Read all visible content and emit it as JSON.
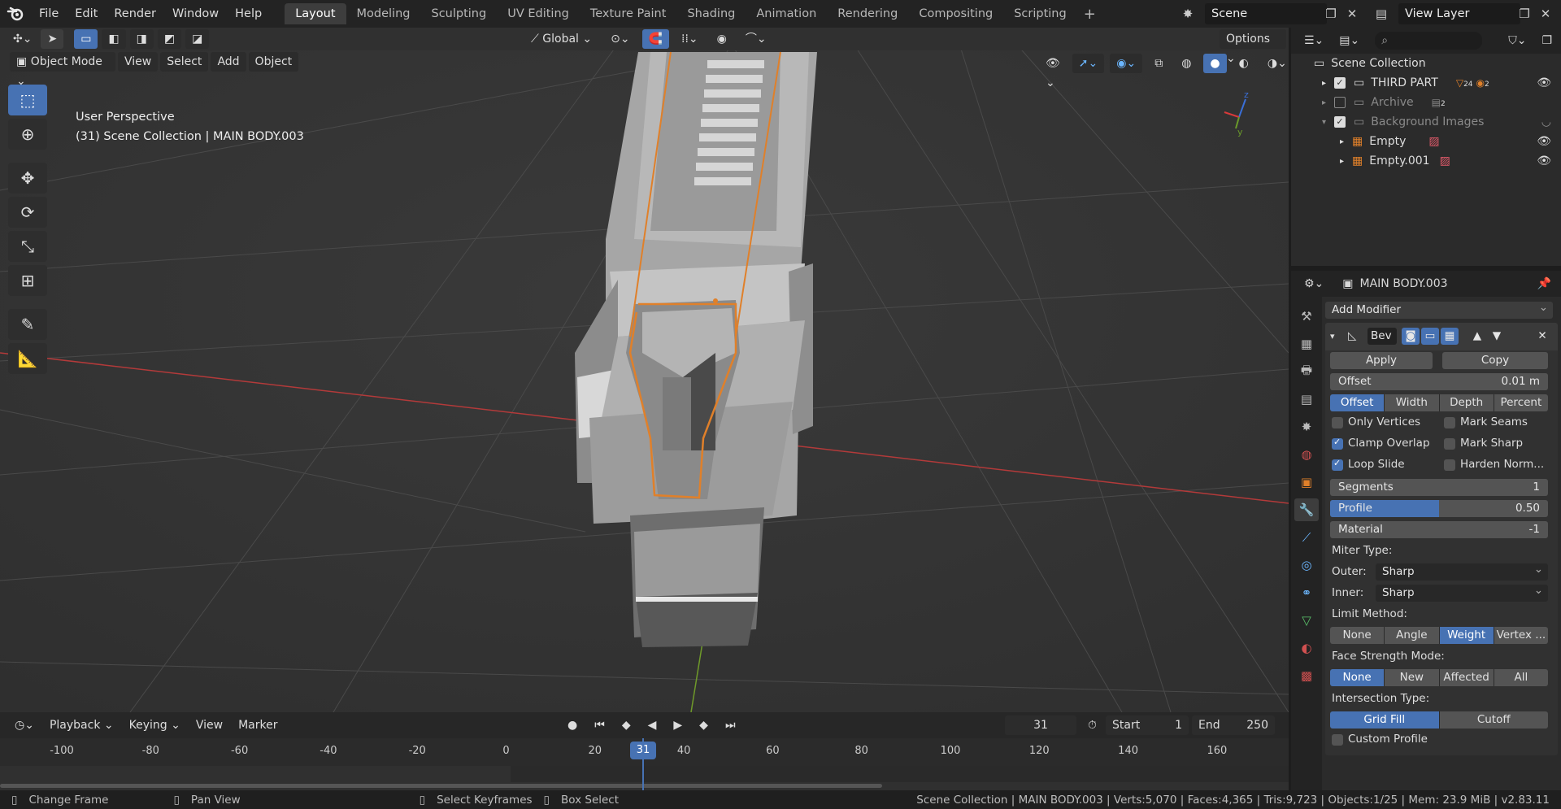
{
  "menu": {
    "file": "File",
    "edit": "Edit",
    "render": "Render",
    "window": "Window",
    "help": "Help"
  },
  "workspaces": [
    "Layout",
    "Modeling",
    "Sculpting",
    "UV Editing",
    "Texture Paint",
    "Shading",
    "Animation",
    "Rendering",
    "Compositing",
    "Scripting"
  ],
  "scene": {
    "name": "Scene",
    "view_layer": "View Layer"
  },
  "viewport": {
    "header": {
      "mode": "Object Mode",
      "view": "View",
      "select": "Select",
      "add": "Add",
      "object": "Object",
      "orientation": "Global",
      "options": "Options"
    },
    "info_line1": "User Perspective",
    "info_line2": "(31) Scene Collection | MAIN BODY.003",
    "gizmo": {
      "z": "z",
      "y": "y"
    }
  },
  "timeline": {
    "playback": "Playback",
    "keying": "Keying",
    "view": "View",
    "marker": "Marker",
    "current_frame": "31",
    "start_label": "Start",
    "start": "1",
    "end_label": "End",
    "end": "250",
    "ticks": [
      "-100",
      "-80",
      "-60",
      "-40",
      "-20",
      "0",
      "20",
      "40",
      "60",
      "80",
      "100",
      "120",
      "140",
      "160"
    ],
    "playhead": "31"
  },
  "status": {
    "change_frame": "Change Frame",
    "pan_view": "Pan View",
    "select_keyframes": "Select Keyframes",
    "box_select": "Box Select",
    "info": "Scene Collection | MAIN BODY.003 | Verts:5,070 | Faces:4,365 | Tris:9,723 | Objects:1/25 | Mem: 23.9 MiB | v2.83.11"
  },
  "outliner": {
    "root": "Scene Collection",
    "items": [
      {
        "label": "THIRD PART",
        "badge1": "24",
        "badge2": "2"
      },
      {
        "label": "Archive",
        "badge1": "2"
      },
      {
        "label": "Background Images"
      },
      {
        "label": "Empty"
      },
      {
        "label": "Empty.001"
      }
    ]
  },
  "properties": {
    "object_name": "MAIN BODY.003",
    "add_modifier": "Add Modifier",
    "modifier_name": "Bev",
    "apply": "Apply",
    "copy": "Copy",
    "offset_label": "Offset",
    "offset_value": "0.01 m",
    "width_type": [
      "Offset",
      "Width",
      "Depth",
      "Percent"
    ],
    "only_vertices": "Only Vertices",
    "mark_seams": "Mark Seams",
    "clamp_overlap": "Clamp Overlap",
    "mark_sharp": "Mark Sharp",
    "loop_slide": "Loop Slide",
    "harden_normals": "Harden Norm...",
    "segments_label": "Segments",
    "segments_value": "1",
    "profile_label": "Profile",
    "profile_value": "0.50",
    "profile_fraction": 0.5,
    "material_label": "Material",
    "material_value": "-1",
    "miter_type": "Miter Type:",
    "outer_label": "Outer:",
    "outer_value": "Sharp",
    "inner_label": "Inner:",
    "inner_value": "Sharp",
    "limit_method": "Limit Method:",
    "limit_options": [
      "None",
      "Angle",
      "Weight",
      "Vertex ..."
    ],
    "face_strength": "Face Strength Mode:",
    "face_options": [
      "None",
      "New",
      "Affected",
      "All"
    ],
    "intersection": "Intersection Type:",
    "intersection_options": [
      "Grid Fill",
      "Cutoff"
    ],
    "custom_profile": "Custom Profile"
  }
}
